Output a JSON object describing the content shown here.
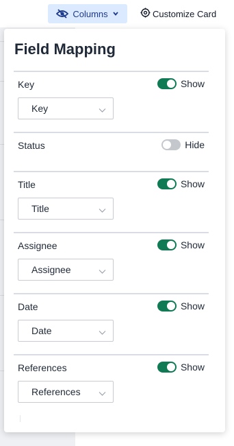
{
  "toolbar": {
    "columns_label": "Columns",
    "customize_label": "Customize Card"
  },
  "panel": {
    "title": "Field Mapping",
    "fields": [
      {
        "label": "Key",
        "state": "Show",
        "enabled": true,
        "select_value": "Key"
      },
      {
        "label": "Status",
        "state": "Hide",
        "enabled": false,
        "select_value": null
      },
      {
        "label": "Title",
        "state": "Show",
        "enabled": true,
        "select_value": "Title"
      },
      {
        "label": "Assignee",
        "state": "Show",
        "enabled": true,
        "select_value": "Assignee"
      },
      {
        "label": "Date",
        "state": "Show",
        "enabled": true,
        "select_value": "Date"
      },
      {
        "label": "References",
        "state": "Show",
        "enabled": true,
        "select_value": "References"
      }
    ]
  },
  "colors": {
    "toggle_on": "#0f7a54",
    "toggle_off": "#c4c8cd",
    "columns_button_bg": "#dbeafe"
  },
  "icons": {
    "columns": "eye-slash-icon",
    "columns_caret": "chevron-down-icon",
    "customize": "gear-icon",
    "select_caret": "chevron-down-icon"
  }
}
